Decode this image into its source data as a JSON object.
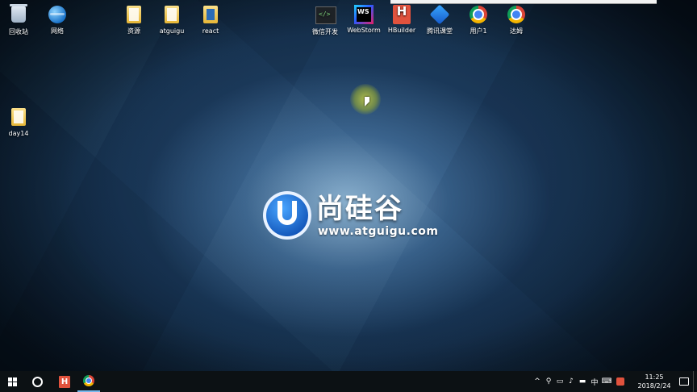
{
  "desktop": {
    "icons": [
      {
        "label": "回收站",
        "icon": "recycle-bin-icon"
      },
      {
        "label": "网络",
        "icon": "network-icon"
      },
      {
        "label": "资源",
        "icon": "folder-icon"
      },
      {
        "label": "atguigu",
        "icon": "folder-icon"
      },
      {
        "label": "react",
        "icon": "document-icon"
      },
      {
        "label": "微信开发",
        "icon": "wechat-devtools-icon"
      },
      {
        "label": "WebStorm",
        "icon": "webstorm-icon"
      },
      {
        "label": "HBuilder",
        "icon": "hbuilder-icon"
      },
      {
        "label": "腾讯课堂",
        "icon": "tencent-classroom-icon"
      },
      {
        "label": "用户1",
        "icon": "chrome-icon"
      },
      {
        "label": "达姆",
        "icon": "chrome-icon"
      },
      {
        "label": "day14",
        "icon": "folder-icon"
      }
    ]
  },
  "wallpaper": {
    "logo_cn": "尚硅谷",
    "logo_url": "www.atguigu.com"
  },
  "taskbar": {
    "apps": [
      "hbuilder-icon",
      "chrome-icon"
    ],
    "tray": {
      "ime": "中",
      "time": "11:25",
      "date": "2018/2/24"
    }
  },
  "colors": {
    "taskbar": "#0c1114",
    "hbuilder": "#e1523d",
    "chrome_active_indicator": "#76b9ed"
  }
}
